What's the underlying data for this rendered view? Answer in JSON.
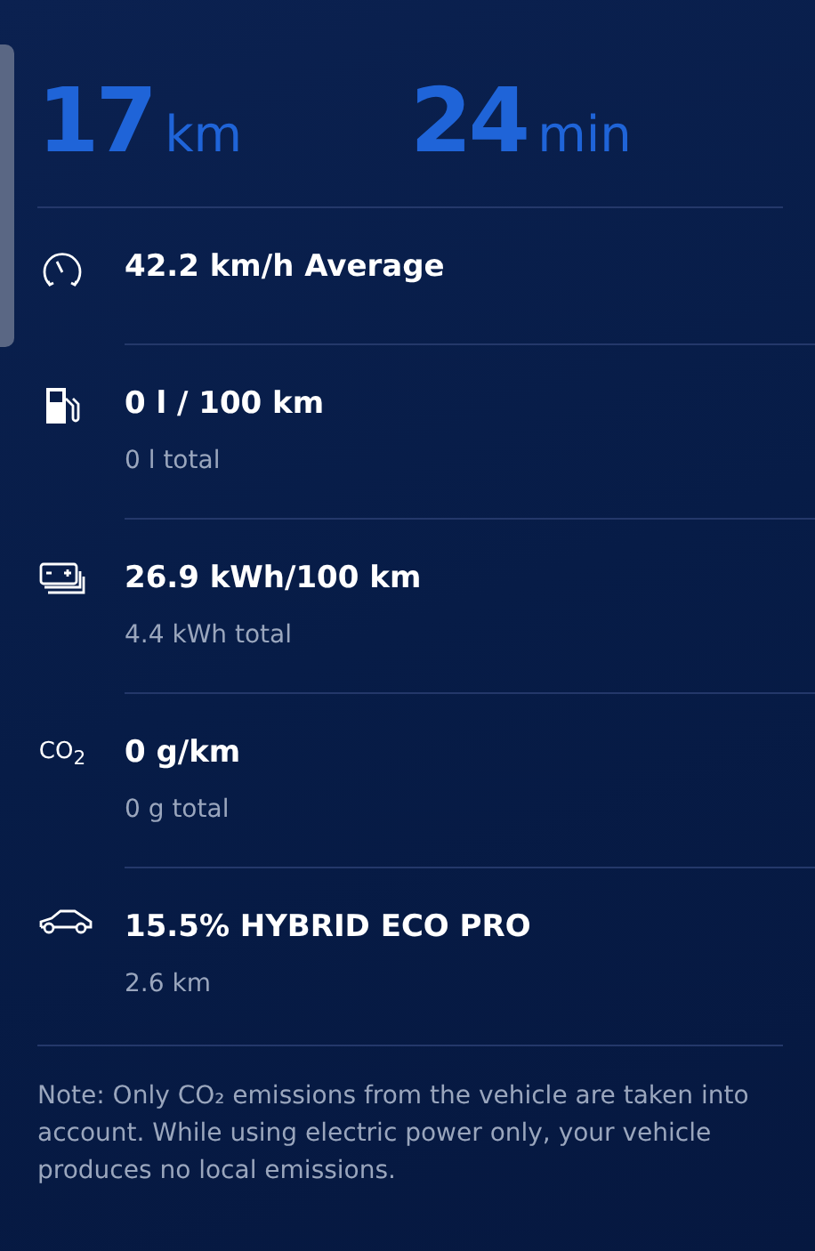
{
  "summary": [
    {
      "value": "17",
      "unit": "km"
    },
    {
      "value": "24",
      "unit": "min"
    }
  ],
  "stats": [
    {
      "kind": "speed",
      "title": "42.2 km/h Average"
    },
    {
      "kind": "fuel",
      "title": "0 l / 100 km",
      "subtitle": "0 l total"
    },
    {
      "kind": "energy",
      "title": "26.9 kWh/100 km",
      "subtitle": "4.4 kWh total"
    },
    {
      "kind": "emission",
      "icon_text": "CO$_{2}$",
      "title": "0 g/km",
      "subtitle": "0 g total"
    },
    {
      "kind": "mode",
      "title": "15.5% HYBRID ECO PRO",
      "subtitle": "2.6 km"
    }
  ],
  "note": "Note: Only CO₂ emissions from the vehicle are taken into account. While using electric power only, your vehicle produces no local emissions."
}
